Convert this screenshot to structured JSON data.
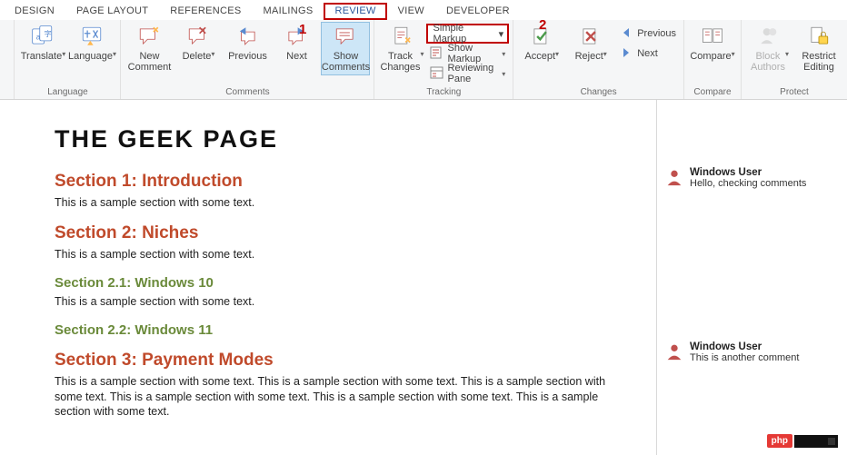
{
  "tabs": {
    "design": "DESIGN",
    "page_layout": "PAGE LAYOUT",
    "references": "REFERENCES",
    "mailings": "MAILINGS",
    "review": "REVIEW",
    "view": "VIEW",
    "developer": "DEVELOPER"
  },
  "callouts": {
    "one": "1",
    "two": "2"
  },
  "ribbon": {
    "language": {
      "label": "Language",
      "translate": "Translate",
      "language": "Language"
    },
    "comments": {
      "label": "Comments",
      "new_comment": "New\nComment",
      "delete": "Delete",
      "previous": "Previous",
      "next": "Next",
      "show_comments": "Show\nComments"
    },
    "tracking": {
      "label": "Tracking",
      "track_changes": "Track\nChanges",
      "markup_select": "Simple Markup",
      "show_markup": "Show Markup",
      "reviewing_pane": "Reviewing Pane"
    },
    "changes": {
      "label": "Changes",
      "accept": "Accept",
      "reject": "Reject",
      "previous": "Previous",
      "next": "Next"
    },
    "compare": {
      "label": "Compare",
      "compare": "Compare"
    },
    "protect": {
      "label": "Protect",
      "block_authors": "Block\nAuthors",
      "restrict_editing": "Restrict\nEditing"
    }
  },
  "doc": {
    "title": "THE GEEK PAGE",
    "s1_h": "Section 1: Introduction",
    "s1_t": "This is a sample section with some text.",
    "s2_h": "Section 2: Niches",
    "s2_t": "This is a sample section with some text.",
    "s21_h": "Section 2.1: Windows 10",
    "s21_t": "This is a sample section with some text.",
    "s22_h": "Section 2.2: Windows 11",
    "s3_h": "Section 3: Payment Modes",
    "s3_t": "This is a sample section with some text. This is a sample section with some text. This is a sample section with some text. This is a sample section with some text. This is a sample section with some text. This is a sample section with some text."
  },
  "comments": {
    "c1_user": "Windows User",
    "c1_text": "Hello, checking comments",
    "c2_user": "Windows User",
    "c2_text": "This is another comment"
  },
  "watermark": {
    "badge": "php"
  }
}
